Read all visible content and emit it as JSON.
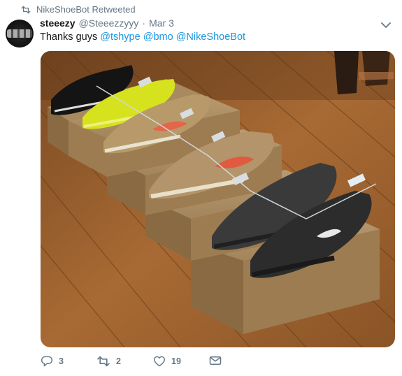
{
  "retweet_banner": {
    "label": "NikeShoeBot Retweeted",
    "icon": "retweet-icon"
  },
  "tweet": {
    "author_name": "steeezy",
    "author_handle": "@Steeezzyyy",
    "separator": "·",
    "date": "Mar 3",
    "text_prefix": "Thanks guys ",
    "mentions": [
      "@tshype",
      "@bmo",
      "@NikeShoeBot"
    ]
  },
  "actions": {
    "reply": {
      "icon": "reply-icon",
      "count": "3"
    },
    "retweet": {
      "icon": "retweet-icon",
      "count": "2"
    },
    "like": {
      "icon": "heart-icon",
      "count": "19"
    },
    "message": {
      "icon": "envelope-icon"
    }
  },
  "colors": {
    "link": "#1b95e0",
    "secondary_text": "#657786",
    "primary_text": "#14171a"
  }
}
